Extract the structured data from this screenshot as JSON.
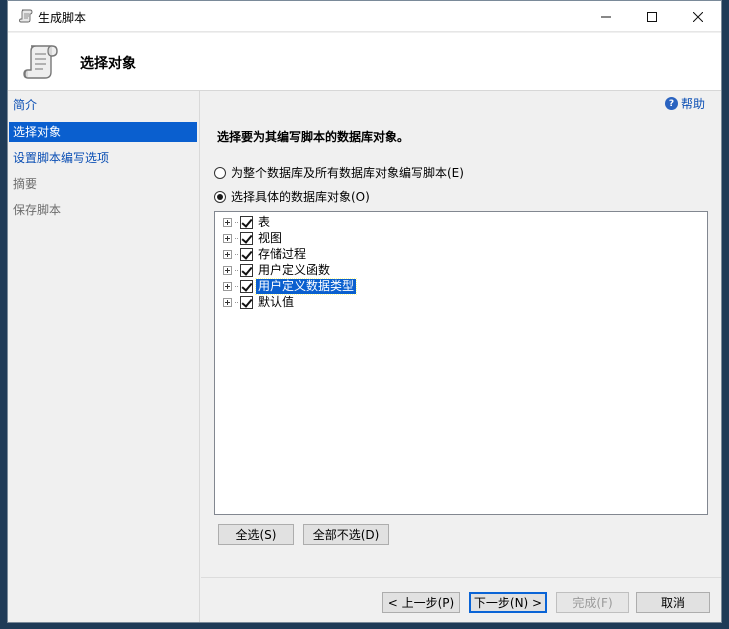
{
  "window": {
    "title": "生成脚本",
    "minimize_label": "—",
    "maximize_label": "☐",
    "close_label": "✕"
  },
  "header": {
    "heading": "选择对象"
  },
  "nav": {
    "items": [
      {
        "label": "简介",
        "state": "link"
      },
      {
        "label": "选择对象",
        "state": "selected"
      },
      {
        "label": "设置脚本编写选项",
        "state": "link"
      },
      {
        "label": "摘要",
        "state": "dim"
      },
      {
        "label": "保存脚本",
        "state": "dim"
      }
    ]
  },
  "content": {
    "help_label": "帮助",
    "help_icon_glyph": "?",
    "instruction": "选择要为其编写脚本的数据库对象。",
    "radio_all": "为整个数据库及所有数据库对象编写脚本(E)",
    "radio_specific": "选择具体的数据库对象(O)",
    "tree_items": [
      {
        "label": "表",
        "checked": true,
        "selected": false
      },
      {
        "label": "视图",
        "checked": true,
        "selected": false
      },
      {
        "label": "存储过程",
        "checked": true,
        "selected": false
      },
      {
        "label": "用户定义函数",
        "checked": true,
        "selected": false
      },
      {
        "label": "用户定义数据类型",
        "checked": true,
        "selected": true
      },
      {
        "label": "默认值",
        "checked": true,
        "selected": false
      }
    ],
    "select_all_label": "全选(S)",
    "deselect_all_label": "全部不选(D)"
  },
  "footer": {
    "prev_label": "< 上一步(P)",
    "next_label": "下一步(N) >",
    "finish_label": "完成(F)",
    "cancel_label": "取消"
  },
  "colors": {
    "accent": "#0a5fcf",
    "link": "#0b4fb4"
  }
}
